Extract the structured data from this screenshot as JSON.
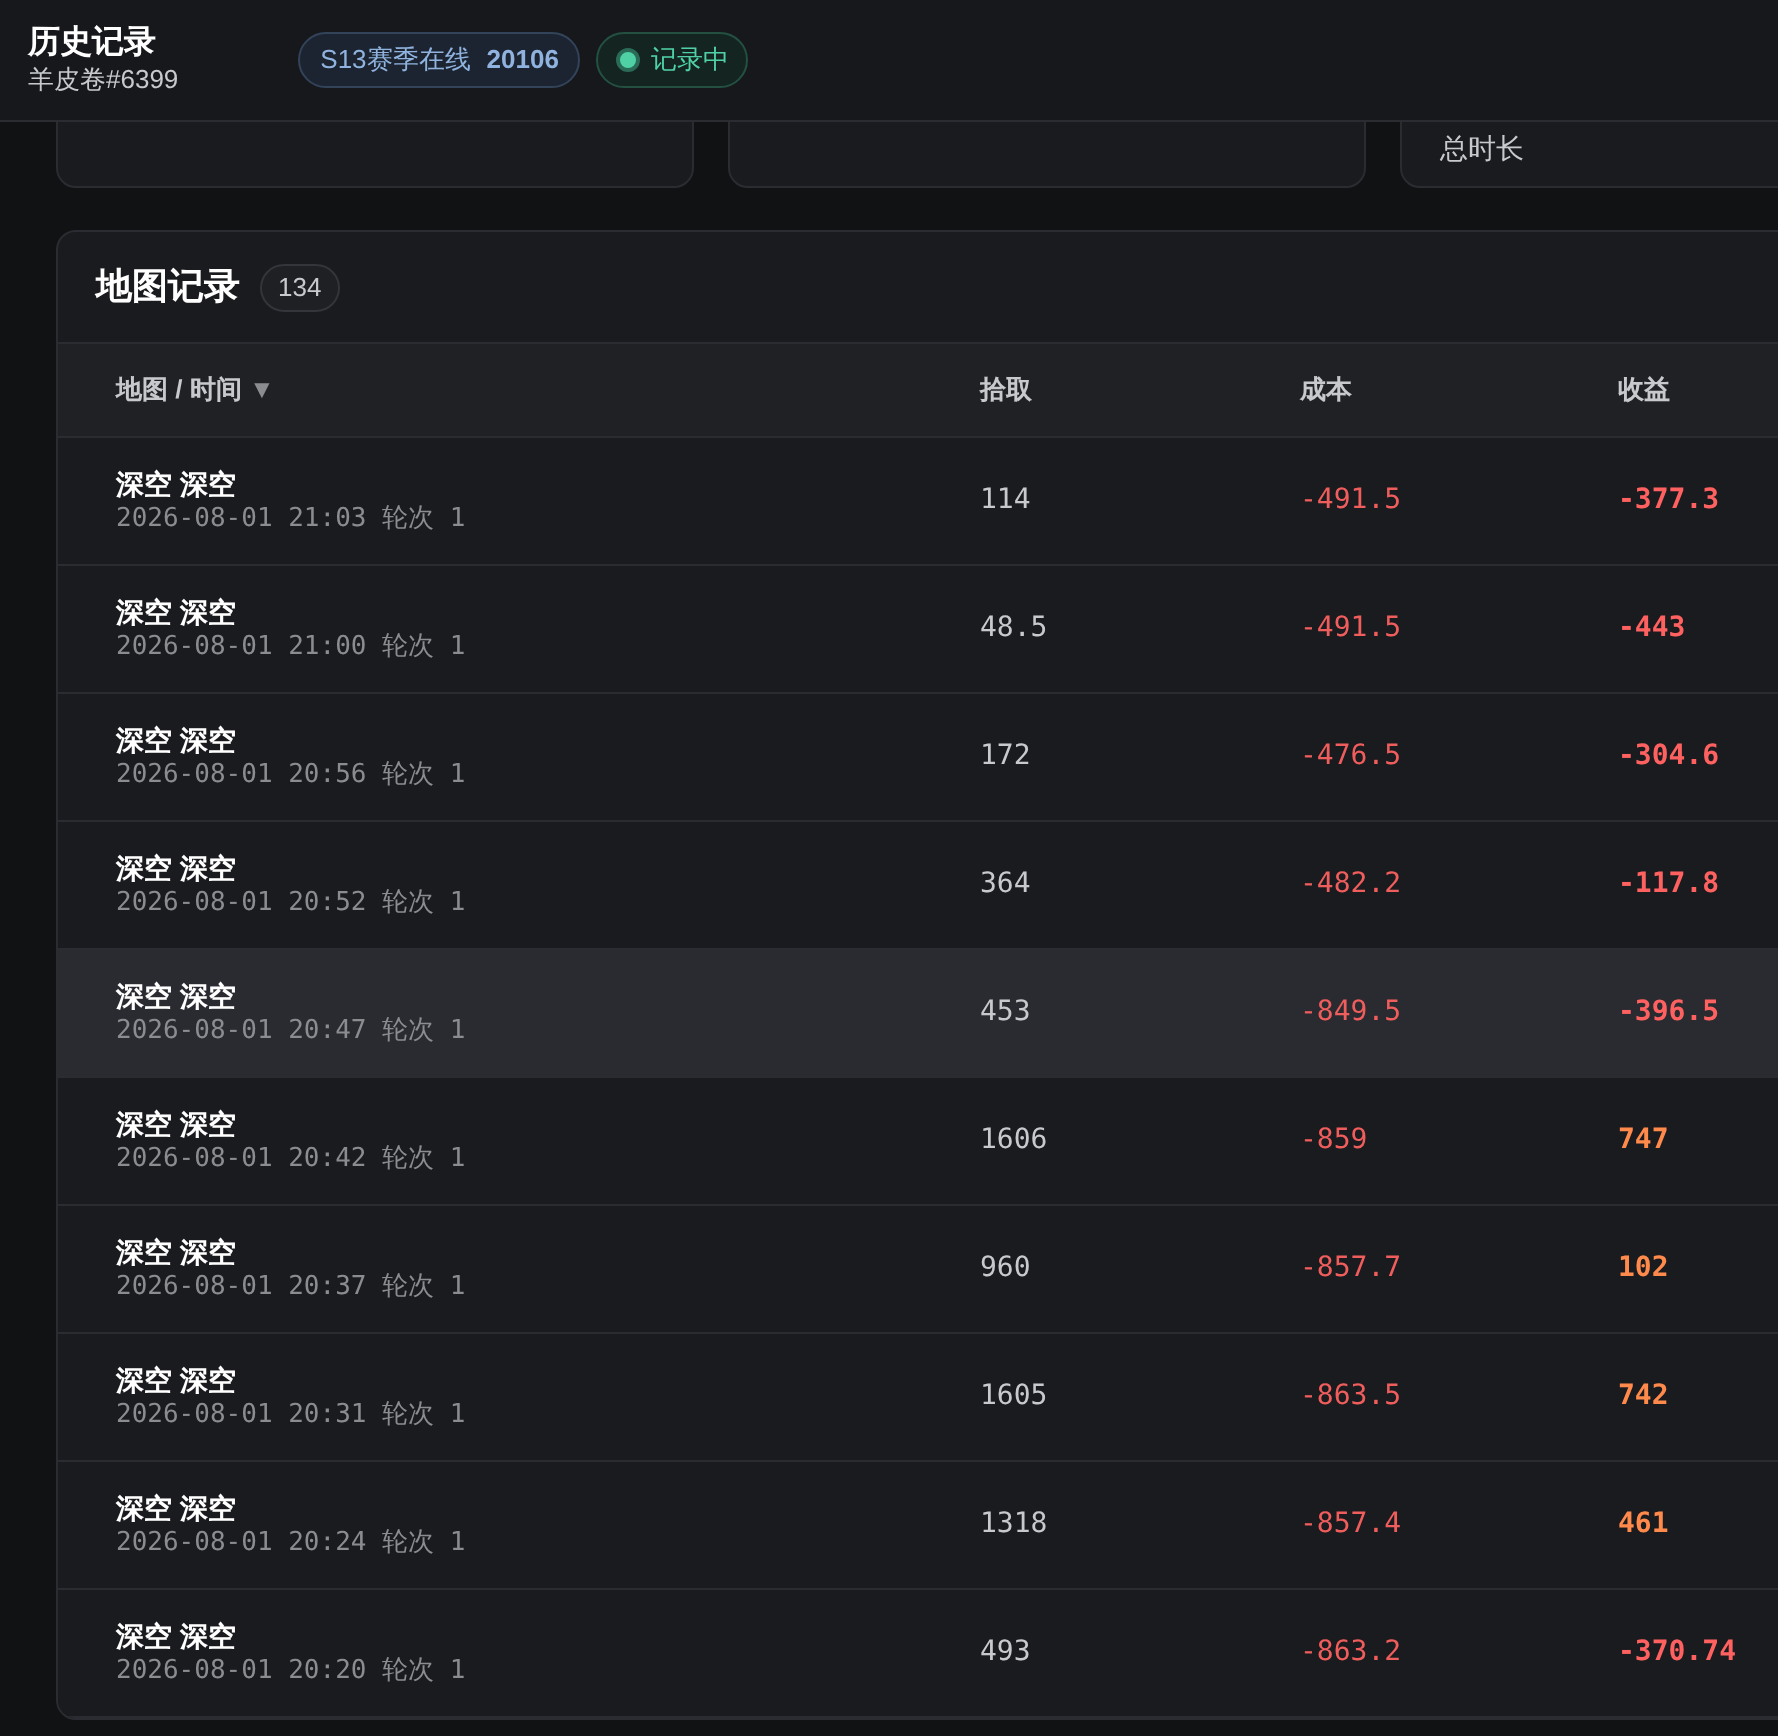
{
  "header": {
    "title": "历史记录",
    "subtitle": "羊皮卷#6399",
    "season_badge": {
      "label": "S13赛季在线",
      "value": "20106"
    },
    "status_badge": {
      "label": "记录中",
      "on": true
    }
  },
  "summary_cards": [
    {
      "kind": "blank"
    },
    {
      "kind": "blank"
    },
    {
      "kind": "stat",
      "label": "总时长"
    }
  ],
  "table": {
    "title": "地图记录",
    "count": "134",
    "columns": [
      {
        "label": "地图 / 时间",
        "sort": "▼"
      },
      {
        "label": "拾取"
      },
      {
        "label": "成本"
      },
      {
        "label": "收益"
      }
    ],
    "rows": [
      {
        "map": "深空 深空",
        "time": "2026-08-01 21:03",
        "round": "轮次 1",
        "pickup": "114",
        "cost": "-491.5",
        "profit": "-377.3",
        "positive": false,
        "selected": false
      },
      {
        "map": "深空 深空",
        "time": "2026-08-01 21:00",
        "round": "轮次 1",
        "pickup": "48.5",
        "cost": "-491.5",
        "profit": "-443",
        "positive": false,
        "selected": false
      },
      {
        "map": "深空 深空",
        "time": "2026-08-01 20:56",
        "round": "轮次 1",
        "pickup": "172",
        "cost": "-476.5",
        "profit": "-304.6",
        "positive": false,
        "selected": false
      },
      {
        "map": "深空 深空",
        "time": "2026-08-01 20:52",
        "round": "轮次 1",
        "pickup": "364",
        "cost": "-482.2",
        "profit": "-117.8",
        "positive": false,
        "selected": false
      },
      {
        "map": "深空 深空",
        "time": "2026-08-01 20:47",
        "round": "轮次 1",
        "pickup": "453",
        "cost": "-849.5",
        "profit": "-396.5",
        "positive": false,
        "selected": true
      },
      {
        "map": "深空 深空",
        "time": "2026-08-01 20:42",
        "round": "轮次 1",
        "pickup": "1606",
        "cost": "-859",
        "profit": "747",
        "positive": true,
        "selected": false
      },
      {
        "map": "深空 深空",
        "time": "2026-08-01 20:37",
        "round": "轮次 1",
        "pickup": "960",
        "cost": "-857.7",
        "profit": "102",
        "positive": true,
        "selected": false
      },
      {
        "map": "深空 深空",
        "time": "2026-08-01 20:31",
        "round": "轮次 1",
        "pickup": "1605",
        "cost": "-863.5",
        "profit": "742",
        "positive": true,
        "selected": false
      },
      {
        "map": "深空 深空",
        "time": "2026-08-01 20:24",
        "round": "轮次 1",
        "pickup": "1318",
        "cost": "-857.4",
        "profit": "461",
        "positive": true,
        "selected": false
      },
      {
        "map": "深空 深空",
        "time": "2026-08-01 20:20",
        "round": "轮次 1",
        "pickup": "493",
        "cost": "-863.2",
        "profit": "-370.74",
        "positive": false,
        "selected": false
      }
    ]
  }
}
